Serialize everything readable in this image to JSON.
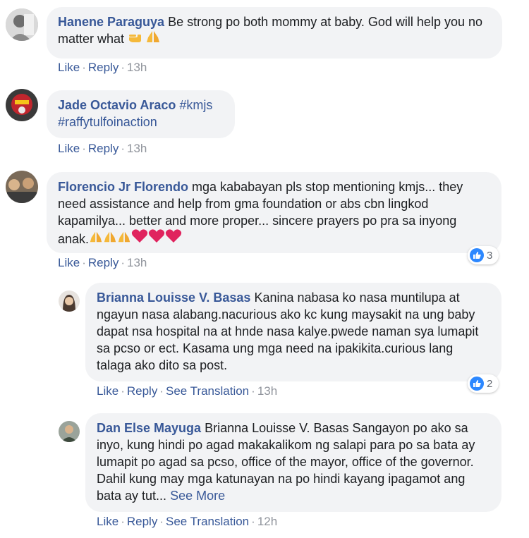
{
  "comments": [
    {
      "name": "Hanene Paraguya",
      "text": "Be strong po both mommy at baby. God will help you no matter what",
      "actions": {
        "like": "Like",
        "reply": "Reply",
        "time": "13h"
      }
    },
    {
      "name": "Jade Octavio Araco",
      "tag1": "#kmjs",
      "tag2": "#raffytulfoinaction",
      "actions": {
        "like": "Like",
        "reply": "Reply",
        "time": "13h"
      }
    },
    {
      "name": "Florencio Jr Florendo",
      "text": "mga kababayan pls stop mentioning kmjs... they need assistance and help from gma foundation or abs cbn lingkod kapamilya... better and more proper... sincere prayers po pra sa inyong anak.",
      "actions": {
        "like": "Like",
        "reply": "Reply",
        "time": "13h"
      },
      "reaction_count": "3"
    },
    {
      "name": "Brianna Louisse V. Basas",
      "text": "Kanina nabasa ko nasa muntilupa at ngayun nasa alabang.nacurious ako kc kung maysakit na ung baby dapat nsa hospital na at hnde nasa kalye.pwede naman sya lumapit sa pcso or ect. Kasama ung mga need na ipakikita.curious lang talaga ako dito sa post.",
      "actions": {
        "like": "Like",
        "reply": "Reply",
        "translate": "See Translation",
        "time": "13h"
      },
      "reaction_count": "2"
    },
    {
      "name": "Dan Else Mayuga",
      "text": "Brianna Louisse V. Basas Sangayon po ako sa inyo, kung hindi po agad makakalikom ng salapi para po sa bata ay lumapit po agad sa pcso, office of the mayor, office of the governor. Dahil kung may mga katunayan na po hindi kayang ipagamot ang bata ay tut...",
      "see_more": "See More",
      "actions": {
        "like": "Like",
        "reply": "Reply",
        "translate": "See Translation",
        "time": "12h"
      }
    }
  ],
  "colors": {
    "name": "#385898",
    "bubble": "#f2f3f5",
    "meta": "#90949c",
    "like_blue": "#2d88ff",
    "heart": "#e0245e"
  }
}
